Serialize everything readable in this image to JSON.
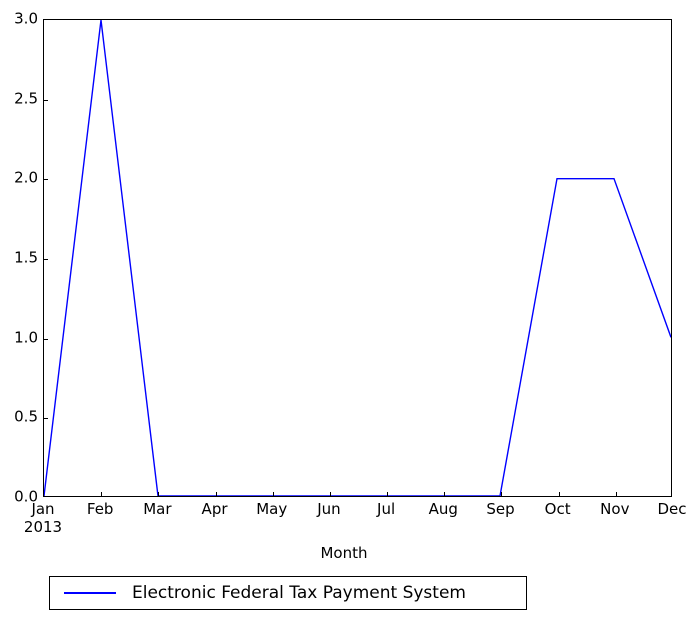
{
  "chart_data": {
    "type": "line",
    "title": "",
    "xlabel": "Month",
    "ylabel": "",
    "categories": [
      "Jan",
      "Feb",
      "Mar",
      "Apr",
      "May",
      "Jun",
      "Jul",
      "Aug",
      "Sep",
      "Oct",
      "Nov",
      "Dec"
    ],
    "x_sublabels": [
      "2013",
      "",
      "",
      "",
      "",
      "",
      "",
      "",
      "",
      "",
      "",
      ""
    ],
    "series": [
      {
        "name": "Electronic Federal Tax Payment System",
        "color": "#0000ff",
        "values": [
          0,
          3,
          0,
          0,
          0,
          0,
          0,
          0,
          0,
          2,
          2,
          1
        ]
      }
    ],
    "ylim": [
      0,
      3
    ],
    "xlim": [
      0,
      11
    ],
    "yticks": [
      0.0,
      0.5,
      1.0,
      1.5,
      2.0,
      2.5,
      3.0
    ],
    "ytick_labels": [
      "0.0",
      "0.5",
      "1.0",
      "1.5",
      "2.0",
      "2.5",
      "3.0"
    ],
    "grid": false,
    "legend_position": "below-axes"
  },
  "axis": {
    "x_title": "Month"
  },
  "legend": {
    "entries": [
      {
        "label": "Electronic Federal Tax Payment System",
        "color": "#0000ff"
      }
    ]
  },
  "colors": {
    "series_blue": "#0000ff",
    "axis_black": "#000000",
    "background": "#ffffff"
  }
}
